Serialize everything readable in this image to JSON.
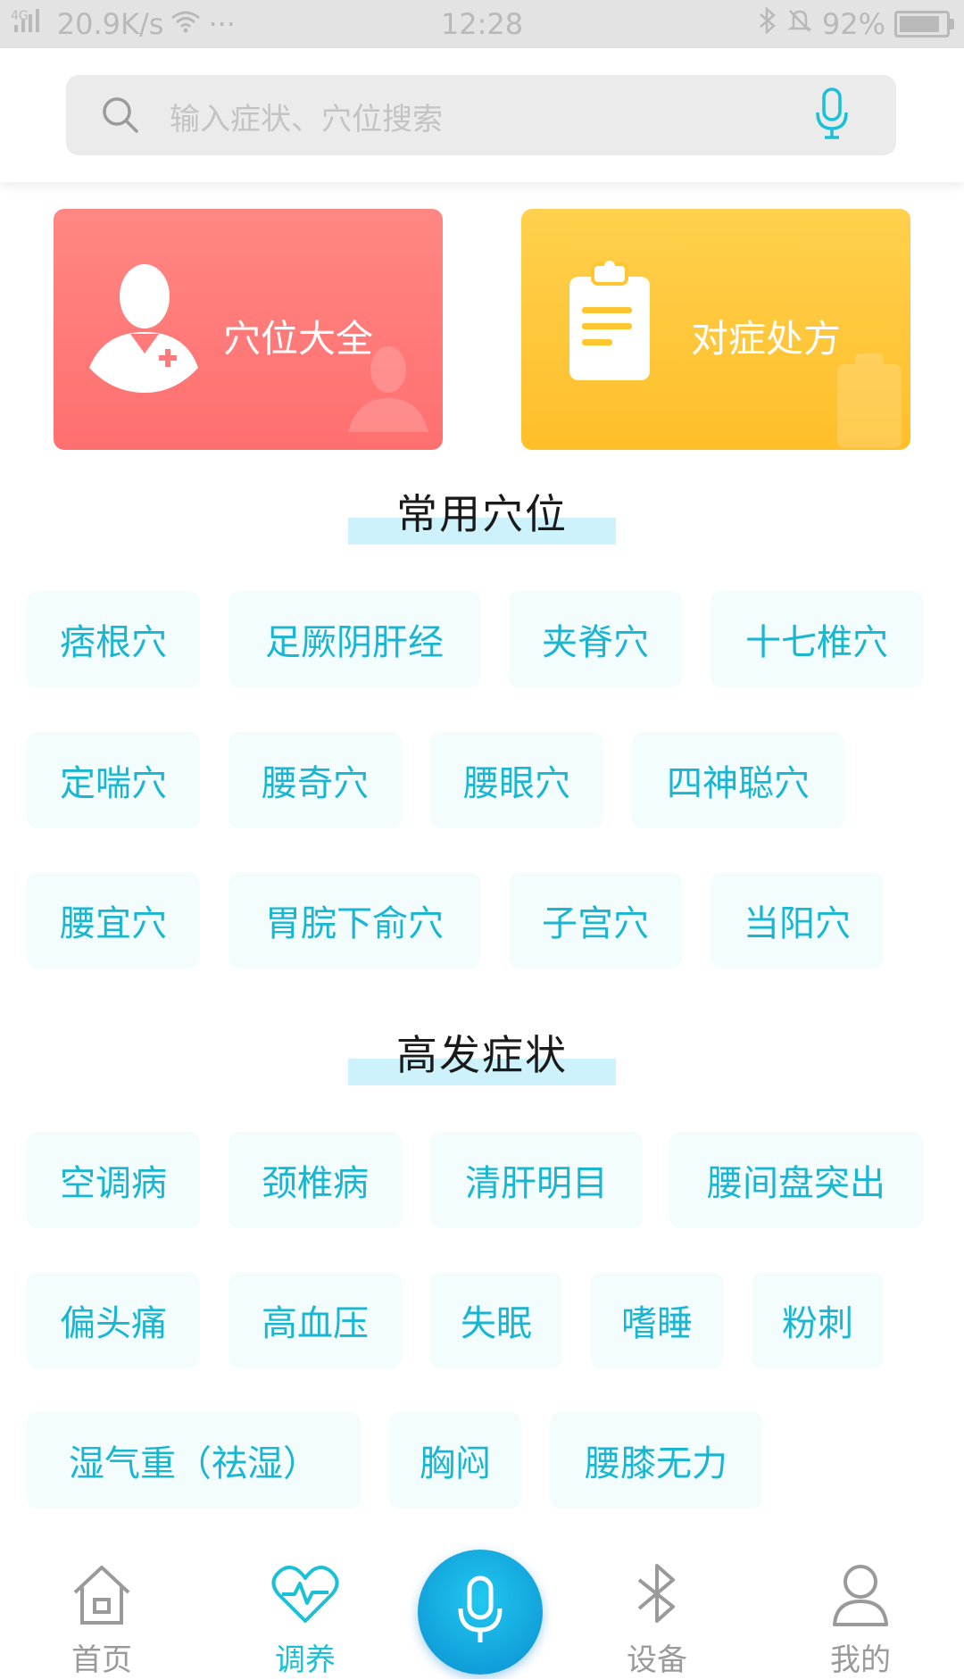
{
  "status_bar": {
    "network": "4G",
    "speed": "20.9K/s",
    "more": "···",
    "time": "12:28",
    "battery": "92%",
    "battery_level": 0.92
  },
  "search": {
    "placeholder": "输入症状、穴位搜索"
  },
  "cards": [
    {
      "label": "穴位大全",
      "color": "#ff7878"
    },
    {
      "label": "对症处方",
      "color": "#ffc632"
    }
  ],
  "sections": {
    "common_acupoints": {
      "title": "常用穴位",
      "tags": [
        "痞根穴",
        "足厥阴肝经",
        "夹脊穴",
        "十七椎穴",
        "定喘穴",
        "腰奇穴",
        "腰眼穴",
        "四神聪穴",
        "腰宜穴",
        "胃脘下俞穴",
        "子宫穴",
        "当阳穴"
      ]
    },
    "common_symptoms": {
      "title": "高发症状",
      "tags": [
        "空调病",
        "颈椎病",
        "清肝明目",
        "腰间盘突出",
        "偏头痛",
        "高血压",
        "失眠",
        "嗜睡",
        "粉刺",
        "湿气重（祛湿）",
        "胸闷",
        "腰膝无力"
      ]
    }
  },
  "bottom_nav": {
    "items": [
      {
        "label": "首页",
        "icon": "home-icon"
      },
      {
        "label": "调养",
        "icon": "heart-pulse-icon"
      },
      {
        "label": "设备",
        "icon": "bluetooth-icon"
      },
      {
        "label": "我的",
        "icon": "user-icon"
      }
    ],
    "center_icon": "mic-icon"
  },
  "colors": {
    "accent": "#19b6d1",
    "tag_bg": "#f3fdfe",
    "title_underline": "#cdf2fb"
  }
}
